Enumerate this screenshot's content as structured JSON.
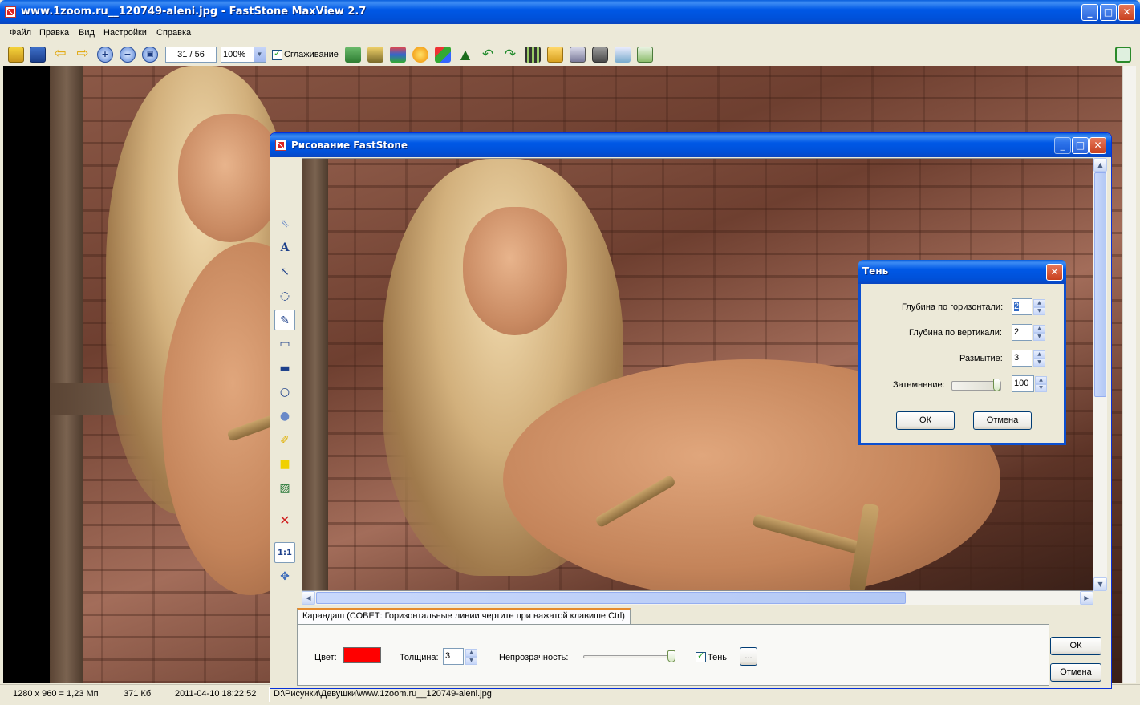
{
  "window": {
    "title": "www.1zoom.ru__120749-aleni.jpg - FastStone MaxView 2.7",
    "menu": [
      "Файл",
      "Правка",
      "Вид",
      "Настройки",
      "Справка"
    ]
  },
  "toolbar": {
    "page_counter": "31 / 56",
    "zoom": "100%",
    "smoothing_label": "Сглаживание",
    "smoothing_checked": true
  },
  "status": {
    "dimensions": "1280 x 960 = 1,23 Мп",
    "size": "371 Кб",
    "datetime": "2011-04-10 18:22:52",
    "path": "D:\\Рисунки\\Девушки\\www.1zoom.ru__120749-aleni.jpg"
  },
  "draw_window": {
    "title": "Рисование FastStone",
    "tools": [
      "select-tool",
      "text-tool",
      "arrow-tool",
      "lasso-tool",
      "pencil-tool",
      "rectangle-tool",
      "filled-rectangle-tool",
      "ellipse-tool",
      "filled-ellipse-tool",
      "highlighter-tool",
      "marker-tool",
      "image-tool",
      "delete-tool",
      "actual-size-tool",
      "fit-tool"
    ],
    "tab_label": "Карандаш (СОВЕТ: Горизонтальные линии чертите при нажатой клавише Ctrl)",
    "color_label": "Цвет:",
    "color_value": "#ff0000",
    "thickness_label": "Толщина:",
    "thickness_value": "3",
    "opacity_label": "Непрозрачность:",
    "shadow_label": "Тень",
    "shadow_checked": true,
    "more_button": "...",
    "ok": "ОК",
    "cancel": "Отмена"
  },
  "shadow_dialog": {
    "title": "Тень",
    "horizontal_label": "Глубина по горизонтали:",
    "horizontal_value": "2",
    "vertical_label": "Глубина по вертикали:",
    "vertical_value": "2",
    "blur_label": "Размытие:",
    "blur_value": "3",
    "darkness_label": "Затемнение:",
    "darkness_value": "100",
    "ok": "ОК",
    "cancel": "Отмена"
  }
}
